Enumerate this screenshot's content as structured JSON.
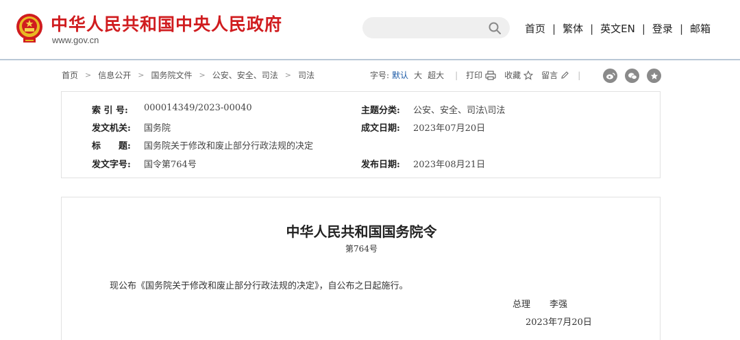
{
  "header": {
    "site_title": "中华人民共和国中央人民政府",
    "site_url": "www.gov.cn",
    "search_placeholder": "",
    "nav": [
      "首页",
      "繁体",
      "英文EN",
      "登录",
      "邮箱"
    ],
    "brand_color": "#d01c1f"
  },
  "breadcrumb": [
    "首页",
    "信息公开",
    "国务院文件",
    "公安、安全、司法",
    "司法"
  ],
  "tools": {
    "font_size_label": "字号:",
    "font_default": "默认",
    "font_large": "大",
    "font_xlarge": "超大",
    "print": "打印",
    "favorite": "收藏",
    "comment": "留言",
    "active_color": "#1c5aa6"
  },
  "share_icons": [
    "weibo-icon",
    "wechat-icon",
    "star-icon"
  ],
  "meta": {
    "index_label": "索 引 号:",
    "index_value": "000014349/2023-00040",
    "topic_label": "主题分类:",
    "topic_value": "公安、安全、司法\\司法",
    "issuer_label": "发文机关:",
    "issuer_value": "国务院",
    "written_label": "成文日期:",
    "written_value": "2023年07月20日",
    "title_label": "标　　题:",
    "title_value": "国务院关于修改和废止部分行政法规的决定",
    "docno_label": "发文字号:",
    "docno_value": "国令第764号",
    "published_label": "发布日期:",
    "published_value": "2023年08月21日"
  },
  "document": {
    "title": "中华人民共和国国务院令",
    "number": "第764号",
    "paragraph": "现公布《国务院关于修改和废止部分行政法规的决定》，自公布之日起施行。",
    "sign_title": "总理",
    "sign_name": "李强",
    "sign_date": "2023年7月20日"
  }
}
